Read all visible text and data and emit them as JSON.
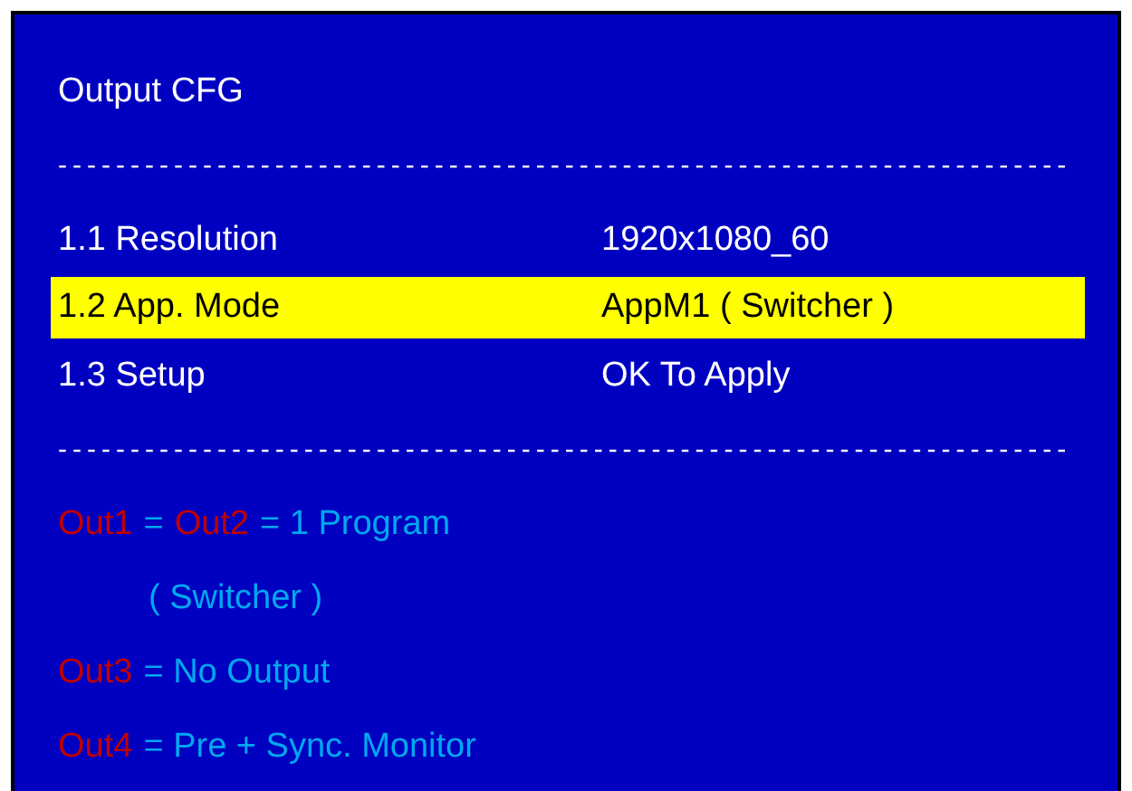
{
  "title": "Output CFG",
  "separators": [
    "----------------------------------------------------------------------",
    "----------------------------------------------------------------------"
  ],
  "menu": [
    {
      "label": "1.1 Resolution",
      "value": "1920x1080_60",
      "selected": false
    },
    {
      "label": "1.2 App. Mode",
      "value": "AppM1 ( Switcher )",
      "selected": true
    },
    {
      "label": "1.3 Setup",
      "value": "OK To Apply",
      "selected": false
    }
  ],
  "legend": [
    {
      "kind": "entry",
      "segments": [
        {
          "kind": "port",
          "text": "Out1"
        },
        {
          "kind": "desc",
          "text": "="
        },
        {
          "kind": "port",
          "text": "Out2"
        },
        {
          "kind": "desc",
          "text": "= 1 Program"
        }
      ]
    },
    {
      "kind": "continuation",
      "segments": [
        {
          "kind": "desc",
          "text": "( Switcher )"
        }
      ]
    },
    {
      "kind": "entry",
      "segments": [
        {
          "kind": "port",
          "text": "Out3"
        },
        {
          "kind": "desc",
          "text": "= No Output"
        }
      ]
    },
    {
      "kind": "entry",
      "segments": [
        {
          "kind": "port",
          "text": "Out4"
        },
        {
          "kind": "desc",
          "text": "= Pre + Sync. Monitor"
        }
      ]
    }
  ]
}
